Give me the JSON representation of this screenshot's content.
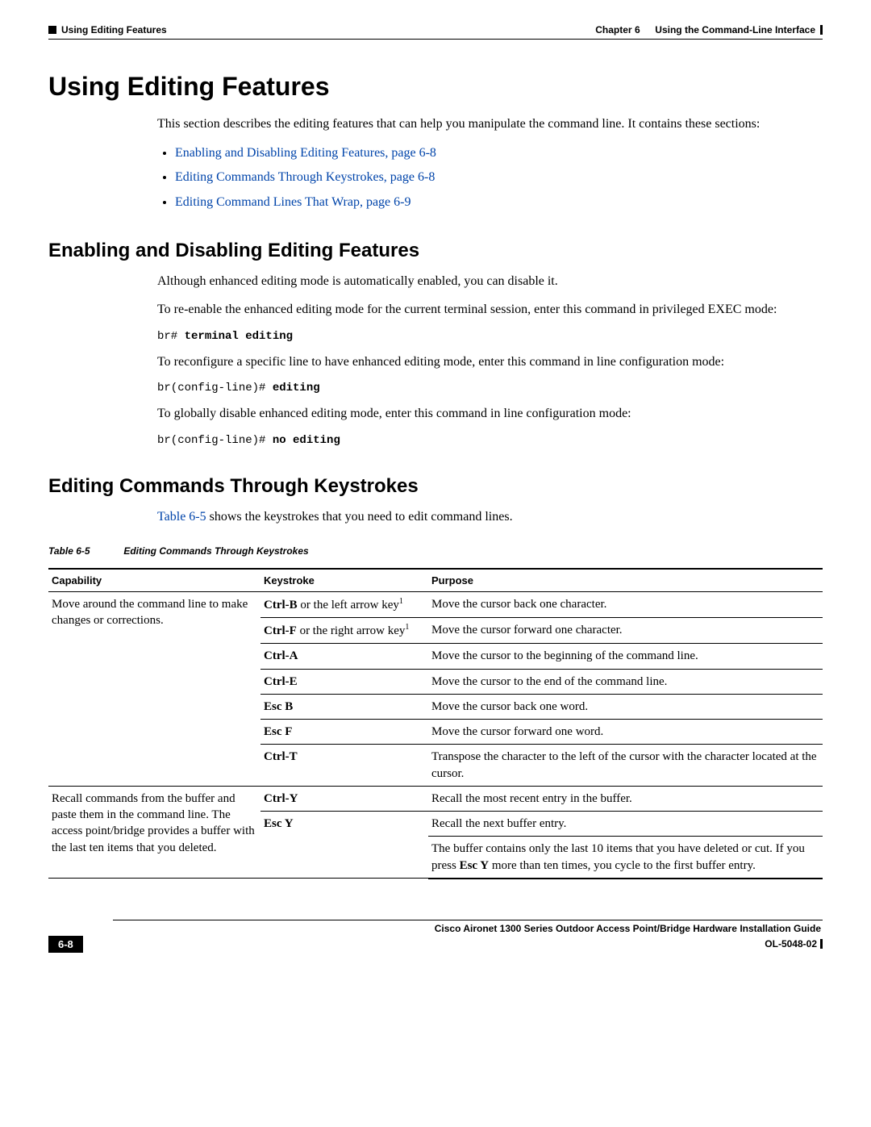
{
  "header": {
    "left_section": "Using Editing Features",
    "right_chapter": "Chapter 6",
    "right_title": "Using the Command-Line Interface"
  },
  "h1": "Using Editing Features",
  "intro": "This section describes the editing features that can help you manipulate the command line. It contains these sections:",
  "toc": [
    "Enabling and Disabling Editing Features, page 6-8",
    "Editing Commands Through Keystrokes, page 6-8",
    "Editing Command Lines That Wrap, page 6-9"
  ],
  "sec1": {
    "title": "Enabling and Disabling Editing Features",
    "p1": "Although enhanced editing mode is automatically enabled, you can disable it.",
    "p2": "To re-enable the enhanced editing mode for the current terminal session, enter this command in privileged EXEC mode:",
    "code1_prompt": "br# ",
    "code1_cmd": "terminal editing",
    "p3": "To reconfigure a specific line to have enhanced editing mode, enter this command in line configuration mode:",
    "code2_prompt": "br(config-line)# ",
    "code2_cmd": "editing",
    "p4": "To globally disable enhanced editing mode, enter this command in line configuration mode:",
    "code3_prompt": "br(config-line)# ",
    "code3_cmd": "no editing"
  },
  "sec2": {
    "title": "Editing Commands Through Keystrokes",
    "lead_ref": "Table 6-5",
    "lead_rest": " shows the keystrokes that you need to edit command lines.",
    "caption_num": "Table 6-5",
    "caption_text": "Editing Commands Through Keystrokes",
    "headers": {
      "c1": "Capability",
      "c2": "Keystroke",
      "c3": "Purpose"
    },
    "cap1": "Move around the command line to make changes or corrections.",
    "cap2": "Recall commands from the buffer and paste them in the command line. The access point/bridge provides a buffer with the last ten items that you deleted.",
    "rows": [
      {
        "k_pre": "Ctrl-B",
        "k_post": " or the left arrow key",
        "p": "Move the cursor back one character."
      },
      {
        "k_pre": "Ctrl-F",
        "k_post": " or the right arrow key",
        "p": "Move the cursor forward one character."
      },
      {
        "k_pre": "Ctrl-A",
        "k_post": "",
        "p": "Move the cursor to the beginning of the command line."
      },
      {
        "k_pre": "Ctrl-E",
        "k_post": "",
        "p": "Move the cursor to the end of the command line."
      },
      {
        "k_pre": "Esc B",
        "k_post": "",
        "p": "Move the cursor back one word."
      },
      {
        "k_pre": "Esc F",
        "k_post": "",
        "p": "Move the cursor forward one word."
      },
      {
        "k_pre": "Ctrl-T",
        "k_post": "",
        "p": "Transpose the character to the left of the cursor with the character located at the cursor."
      },
      {
        "k_pre": "Ctrl-Y",
        "k_post": "",
        "p": "Recall the most recent entry in the buffer."
      },
      {
        "k_pre": "Esc Y",
        "k_post": "",
        "p": "Recall the next buffer entry."
      }
    ],
    "buffer_note_a": "The buffer contains only the last 10 items that you have deleted or cut. If you press ",
    "buffer_note_b": "Esc Y",
    "buffer_note_c": " more than ten times, you cycle to the first buffer entry."
  },
  "footer": {
    "guide": "Cisco Aironet 1300 Series Outdoor Access Point/Bridge Hardware Installation Guide",
    "page": "6-8",
    "docnum": "OL-5048-02"
  }
}
